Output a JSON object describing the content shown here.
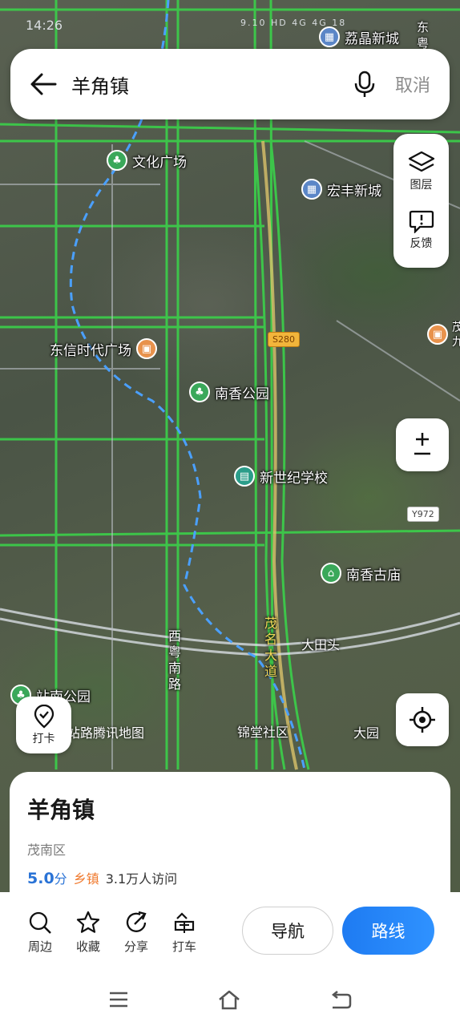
{
  "status": {
    "time": "14:26",
    "indicators": "9.10 HD 4G 4G 18"
  },
  "search": {
    "query": "羊角镇",
    "cancel_label": "取消"
  },
  "side_controls": {
    "layers_label": "图层",
    "feedback_label": "反馈"
  },
  "checkin_label": "打卡",
  "map": {
    "pois": [
      {
        "name": "荔晶新城",
        "icon": "building-icon"
      },
      {
        "name": "文化广场",
        "icon": "park-icon"
      },
      {
        "name": "宏丰新城",
        "icon": "building-icon"
      },
      {
        "name": "东信时代广场",
        "icon": "shopping-icon"
      },
      {
        "name": "南香公园",
        "icon": "park-icon"
      },
      {
        "name": "新世纪学校",
        "icon": "school-icon"
      },
      {
        "name": "南香古庙",
        "icon": "temple-icon"
      },
      {
        "name": "站南公园",
        "icon": "park-icon"
      }
    ],
    "labels": {
      "top_right": "东粤",
      "right_edge": "茂\n九",
      "datiantou": "大田头",
      "jintang": "锦堂社区",
      "dayuan": "大园",
      "zhan_road": "站路",
      "road_west": "西粤南路",
      "road_maoming": "茂名大道"
    },
    "road_badges": {
      "s280": "S280",
      "y972": "Y972"
    },
    "watermark": "腾讯地图"
  },
  "place": {
    "name": "羊角镇",
    "district": "茂南区",
    "rating_value": "5.0",
    "rating_unit": "分",
    "category": "乡镇",
    "visits": "3.1万人访问"
  },
  "actions": {
    "nearby": "周边",
    "favorite": "收藏",
    "share": "分享",
    "taxi": "打车",
    "navigate": "导航",
    "route": "路线"
  }
}
